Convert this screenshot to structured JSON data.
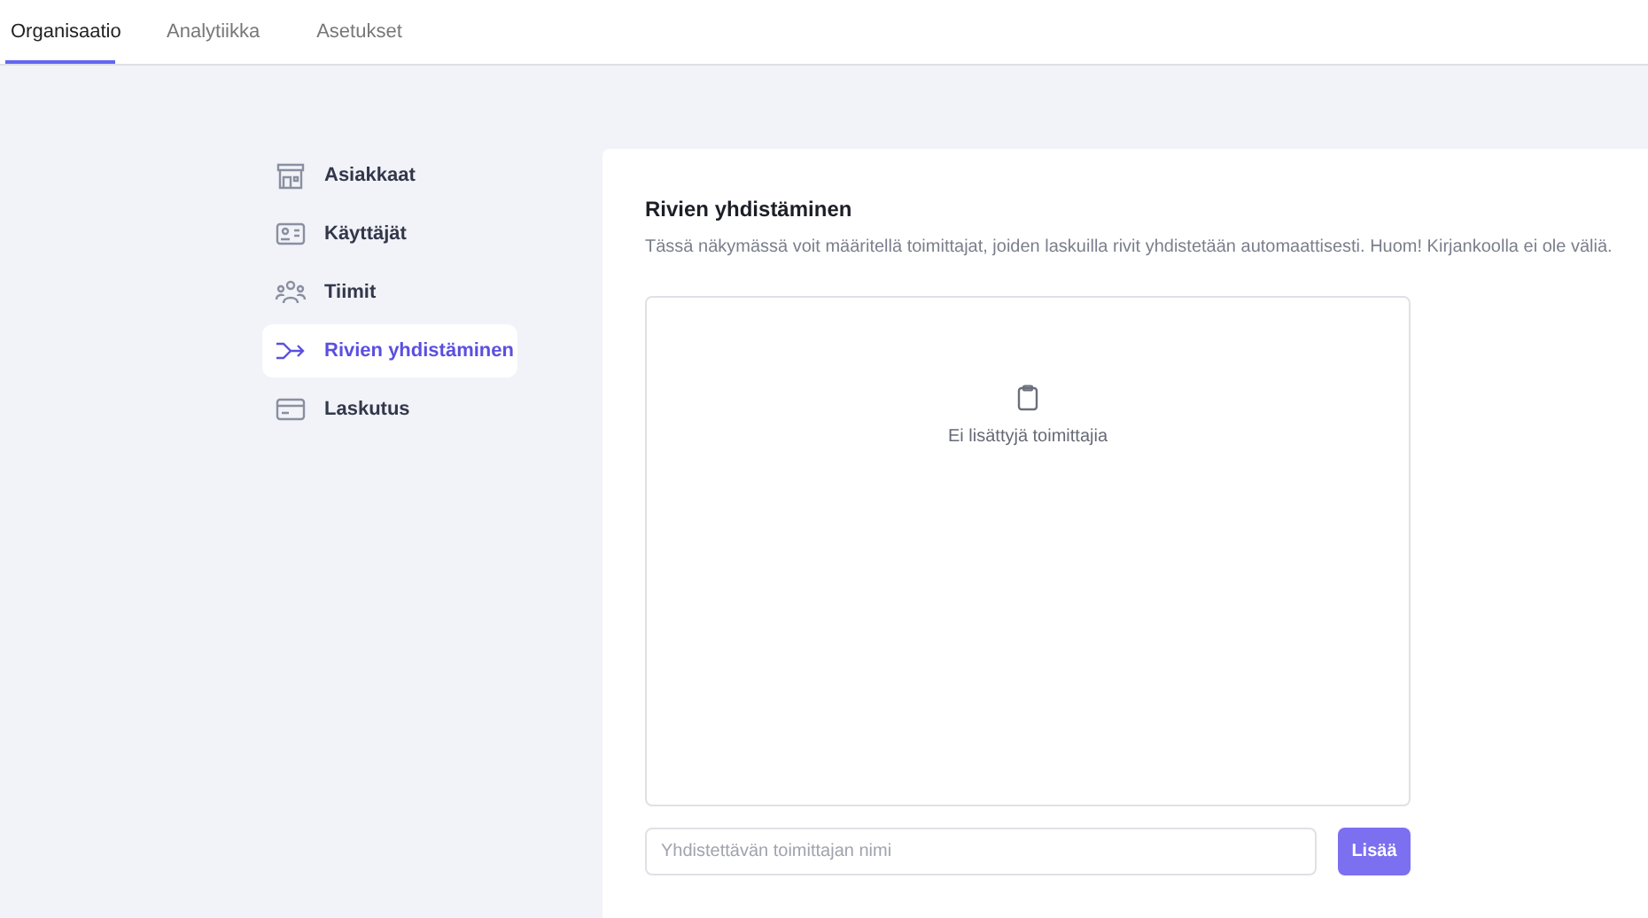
{
  "tabs": [
    {
      "label": "Organisaatio",
      "selected": true
    },
    {
      "label": "Analytiikka",
      "selected": false
    },
    {
      "label": "Asetukset",
      "selected": false
    }
  ],
  "sidebar": {
    "items": [
      {
        "label": "Asiakkaat",
        "selected": false
      },
      {
        "label": "Käyttäjät",
        "selected": false
      },
      {
        "label": "Tiimit",
        "selected": false
      },
      {
        "label": "Rivien yhdistäminen",
        "selected": true
      },
      {
        "label": "Laskutus",
        "selected": false
      }
    ]
  },
  "panel": {
    "title": "Rivien yhdistäminen",
    "description": "Tässä näkymässä voit määritellä toimittajat, joiden laskuilla rivit yhdistetään automaattisesti. Huom! Kirjankoolla ei ole väliä.",
    "empty_message": "Ei lisättyjä toimittajia",
    "input": {
      "placeholder": "Yhdistettävän toimittajan nimi"
    },
    "button": "Lisää"
  }
}
